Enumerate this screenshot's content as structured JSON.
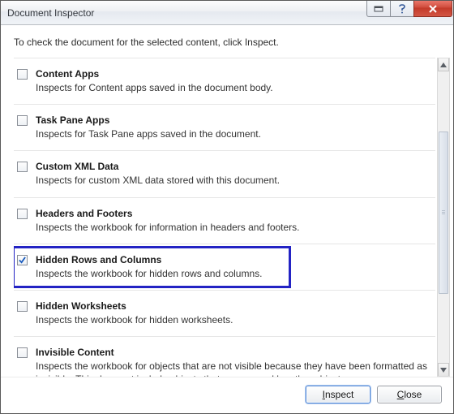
{
  "window": {
    "title": "Document Inspector"
  },
  "instruction": "To check the document for the selected content, click Inspect.",
  "items": [
    {
      "title": "Content Apps",
      "desc": "Inspects for Content apps saved in the document body.",
      "checked": false,
      "highlighted": false
    },
    {
      "title": "Task Pane Apps",
      "desc": "Inspects for Task Pane apps saved in the document.",
      "checked": false,
      "highlighted": false
    },
    {
      "title": "Custom XML Data",
      "desc": "Inspects for custom XML data stored with this document.",
      "checked": false,
      "highlighted": false
    },
    {
      "title": "Headers and Footers",
      "desc": "Inspects the workbook for information in headers and footers.",
      "checked": false,
      "highlighted": false
    },
    {
      "title": "Hidden Rows and Columns",
      "desc": "Inspects the workbook for hidden rows and columns.",
      "checked": true,
      "highlighted": true
    },
    {
      "title": "Hidden Worksheets",
      "desc": "Inspects the workbook for hidden worksheets.",
      "checked": false,
      "highlighted": false
    },
    {
      "title": "Invisible Content",
      "desc": "Inspects the workbook for objects that are not visible because they have been formatted as invisible. This does not include objects that are covered by other objects.",
      "checked": false,
      "highlighted": false
    }
  ],
  "buttons": {
    "inspect": "Inspect",
    "close": "Close"
  }
}
